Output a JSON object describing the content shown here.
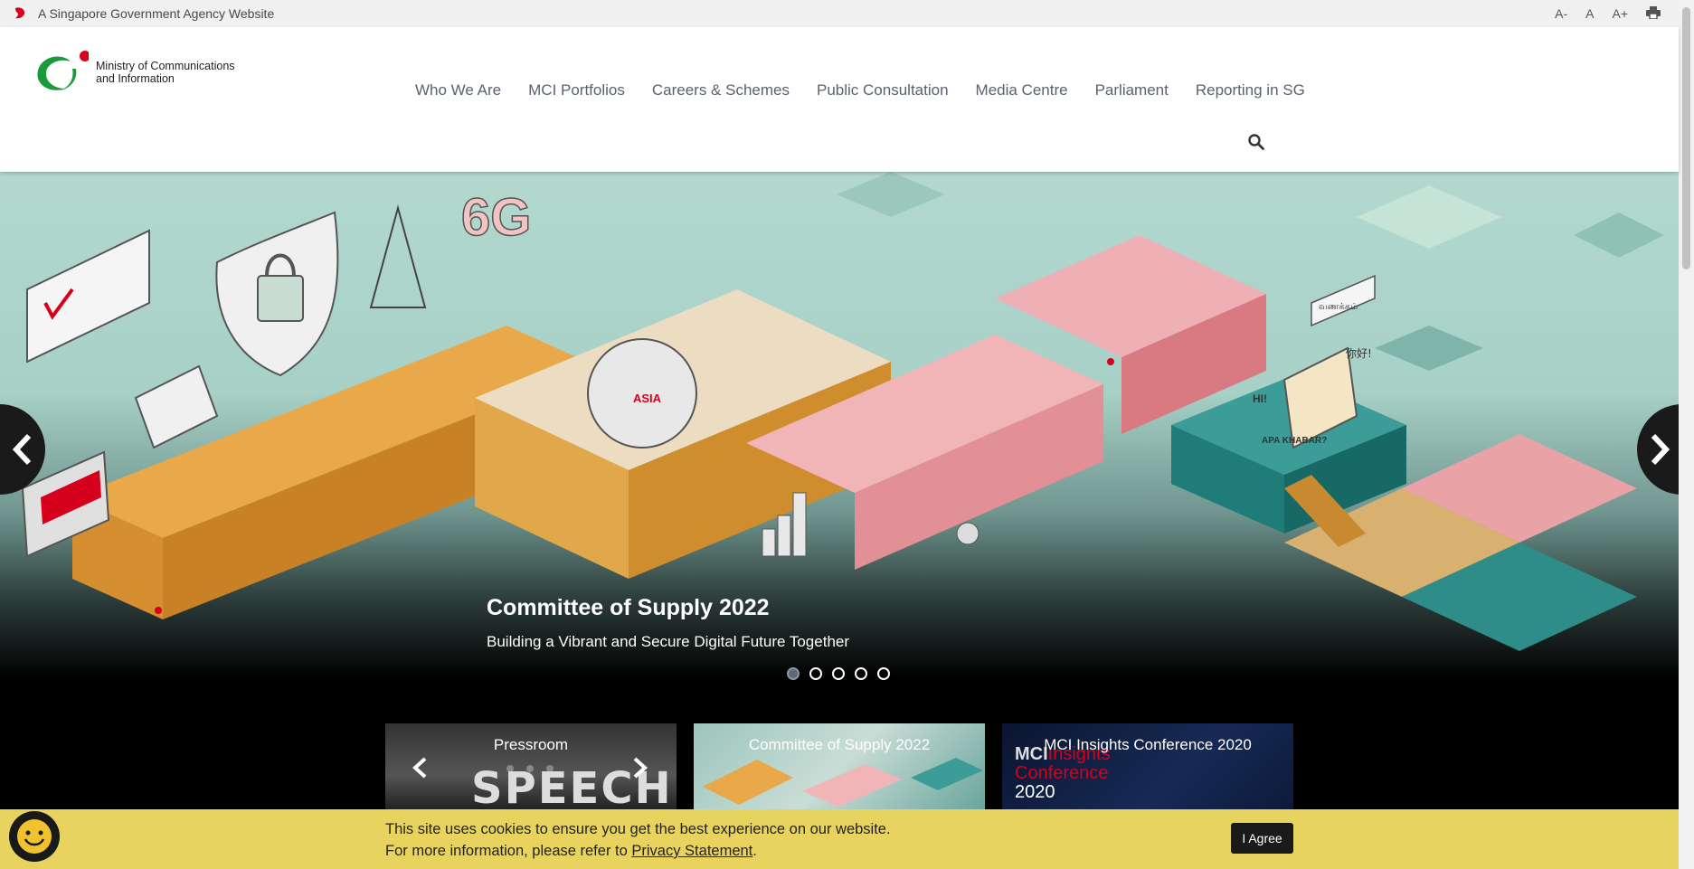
{
  "masthead": {
    "gov_text": "A Singapore Government Agency Website",
    "font_smaller": "A-",
    "font_normal": "A",
    "font_larger": "A+",
    "print_icon": "print-icon"
  },
  "logo": {
    "line1": "Ministry of Communications",
    "line2": "and Information"
  },
  "nav": {
    "items": [
      "Who We Are",
      "MCI Portfolios",
      "Careers & Schemes",
      "Public Consultation",
      "Media Centre",
      "Parliament",
      "Reporting in SG"
    ],
    "search_icon": "search-icon"
  },
  "hero": {
    "title": "Committee of Supply 2022",
    "subtitle": "Building a Vibrant and Secure Digital Future Together",
    "slide_count": 5,
    "active_slide": 1,
    "art_labels": [
      "6G",
      "ASIA",
      "HI!",
      "APA KHABAR?",
      "வணக்கம்",
      "你好!"
    ]
  },
  "cards": [
    {
      "title": "Pressroom",
      "overlay_text": "SPEECH"
    },
    {
      "title": "Committee of Supply 2022"
    },
    {
      "title": "MCI Insights Conference 2020",
      "overlay_line1": "MCI",
      "overlay_line1b": "Insights",
      "overlay_line2": "Conference",
      "overlay_line3": "2020"
    }
  ],
  "cookie": {
    "line1": "This site uses cookies to ensure you get the best experience on our website.",
    "line2_prefix": "For more information, please refer to ",
    "link": "Privacy Statement",
    "line2_suffix": ".",
    "button": "I Agree"
  },
  "colors": {
    "accent_red": "#d6001c",
    "logo_green": "#1a9a3a",
    "cookie_bg": "#e9d35f",
    "nav_text": "#5a6270"
  }
}
